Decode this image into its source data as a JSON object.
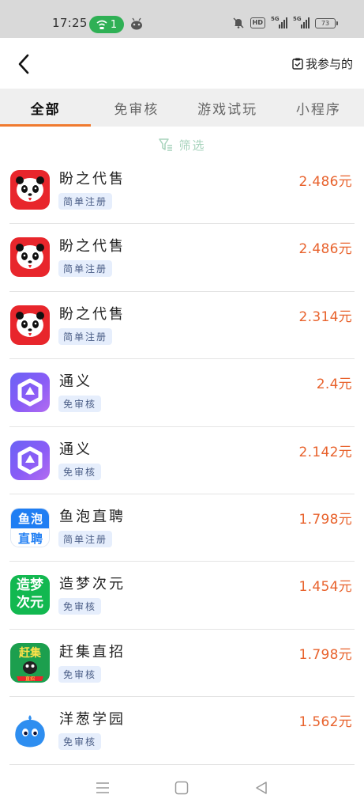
{
  "status_bar": {
    "time": "17:25",
    "hotspot_count": "1",
    "network_1": "5G",
    "network_2": "5G",
    "battery": "73",
    "hd_label": "HD"
  },
  "header": {
    "my_joined_label": "我参与的"
  },
  "tabs": [
    {
      "label": "全部",
      "active": true
    },
    {
      "label": "免审核",
      "active": false
    },
    {
      "label": "游戏试玩",
      "active": false
    },
    {
      "label": "小程序",
      "active": false
    }
  ],
  "filter": {
    "label": "筛选"
  },
  "apps": [
    {
      "name": "盼之代售",
      "tag": "简单注册",
      "price": "2.486元",
      "icon": "panda-icon"
    },
    {
      "name": "盼之代售",
      "tag": "简单注册",
      "price": "2.486元",
      "icon": "panda-icon"
    },
    {
      "name": "盼之代售",
      "tag": "简单注册",
      "price": "2.314元",
      "icon": "panda-icon"
    },
    {
      "name": "通义",
      "tag": "免审核",
      "price": "2.4元",
      "icon": "tongyi-icon"
    },
    {
      "name": "通义",
      "tag": "免审核",
      "price": "2.142元",
      "icon": "tongyi-icon"
    },
    {
      "name": "鱼泡直聘",
      "tag": "简单注册",
      "price": "1.798元",
      "icon": "yupao-icon",
      "icon_text_top": "鱼泡",
      "icon_text_bottom": "直聘"
    },
    {
      "name": "造梦次元",
      "tag": "免审核",
      "price": "1.454元",
      "icon": "zaomeng-icon",
      "icon_text_top": "造梦",
      "icon_text_bottom": "次元"
    },
    {
      "name": "赶集直招",
      "tag": "免审核",
      "price": "1.798元",
      "icon": "ganji-icon",
      "icon_text_top": "赶集",
      "icon_text_bottom": "直招"
    },
    {
      "name": "洋葱学园",
      "tag": "免审核",
      "price": "1.562元",
      "icon": "yangcong-icon"
    }
  ],
  "colors": {
    "accent_orange": "#f07a2f",
    "price_red": "#e8622c",
    "filter_green": "#a7d3bc",
    "tag_bg": "#e6eefc"
  }
}
